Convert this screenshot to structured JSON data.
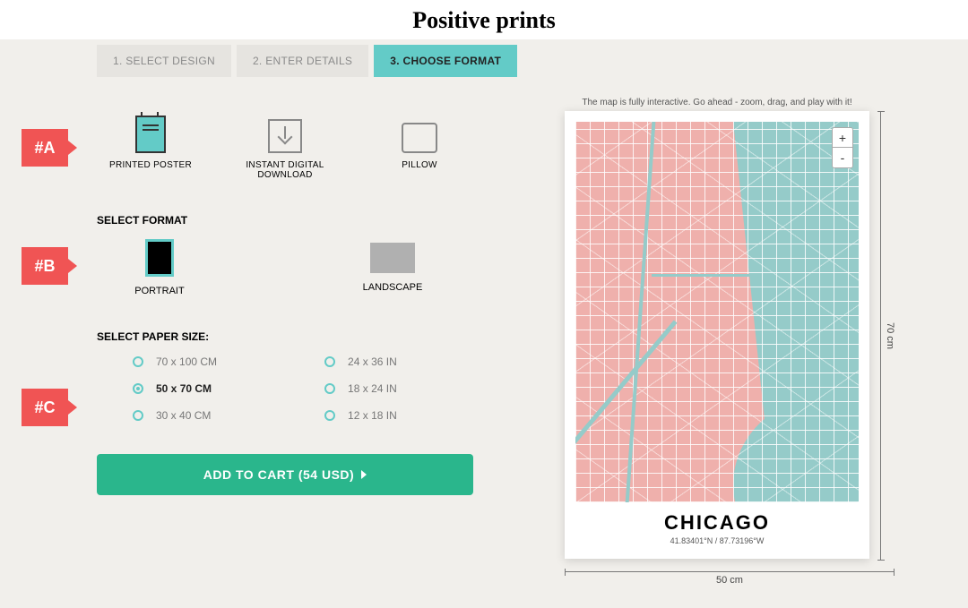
{
  "brand": "Positive prints",
  "tabs": {
    "t1": "1. SELECT DESIGN",
    "t2": "2. ENTER DETAILS",
    "t3": "3. CHOOSE FORMAT"
  },
  "products": {
    "poster": "PRINTED POSTER",
    "download": "INSTANT DIGITAL DOWNLOAD",
    "pillow": "PILLOW"
  },
  "sections": {
    "format": "SELECT FORMAT",
    "paper": "SELECT PAPER SIZE:"
  },
  "formats": {
    "portrait": "PORTRAIT",
    "landscape": "LANDSCAPE"
  },
  "sizes": {
    "cm1": "70 x 100 CM",
    "cm2": "50 x 70 CM",
    "cm3": "30 x 40 CM",
    "in1": "24 x 36 IN",
    "in2": "18 x 24 IN",
    "in3": "12 x 18 IN"
  },
  "cart": "ADD TO CART (54 USD)",
  "preview": {
    "hint": "The map is fully interactive. Go ahead - zoom, drag, and play with it!",
    "title": "CHICAGO",
    "coords": "41.83401°N / 87.73196°W",
    "width_label": "50 cm",
    "height_label": "70 cm",
    "zoom_in": "+",
    "zoom_out": "-"
  },
  "markers": {
    "a": "#A",
    "b": "#B",
    "c": "#C"
  }
}
